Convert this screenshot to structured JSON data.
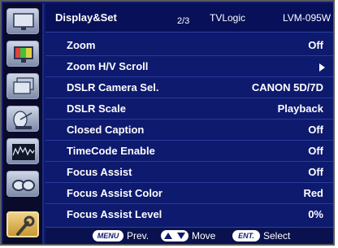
{
  "header": {
    "title": "Display&Set",
    "page": "2/3",
    "brand": "TVLogic",
    "model": "LVM-095W"
  },
  "sidebar": {
    "items": [
      {
        "icon": "monitor-icon"
      },
      {
        "icon": "color-monitor-icon"
      },
      {
        "icon": "layered-monitor-icon"
      },
      {
        "icon": "satellite-dish-icon"
      },
      {
        "icon": "waveform-icon"
      },
      {
        "icon": "glasses-icon"
      },
      {
        "icon": "wrench-icon",
        "active": true
      }
    ]
  },
  "menu": {
    "items": [
      {
        "label": "Zoom",
        "value": "Off"
      },
      {
        "label": "Zoom H/V Scroll",
        "value": ""
      },
      {
        "label": "DSLR Camera Sel.",
        "value": "CANON 5D/7D"
      },
      {
        "label": "DSLR Scale",
        "value": "Playback"
      },
      {
        "label": "Closed Caption",
        "value": "Off"
      },
      {
        "label": "TimeCode Enable",
        "value": "Off"
      },
      {
        "label": "Focus Assist",
        "value": "Off"
      },
      {
        "label": "Focus Assist Color",
        "value": "Red"
      },
      {
        "label": "Focus Assist Level",
        "value": "0%"
      }
    ]
  },
  "footer": {
    "menu_key": "MENU",
    "prev_label": "Prev.",
    "move_label": "Move",
    "ent_key": "ENT.",
    "select_label": "Select"
  },
  "colors": {
    "background": "#0d1a6e",
    "header": "#08105a",
    "active_tab": "#e0b456"
  }
}
